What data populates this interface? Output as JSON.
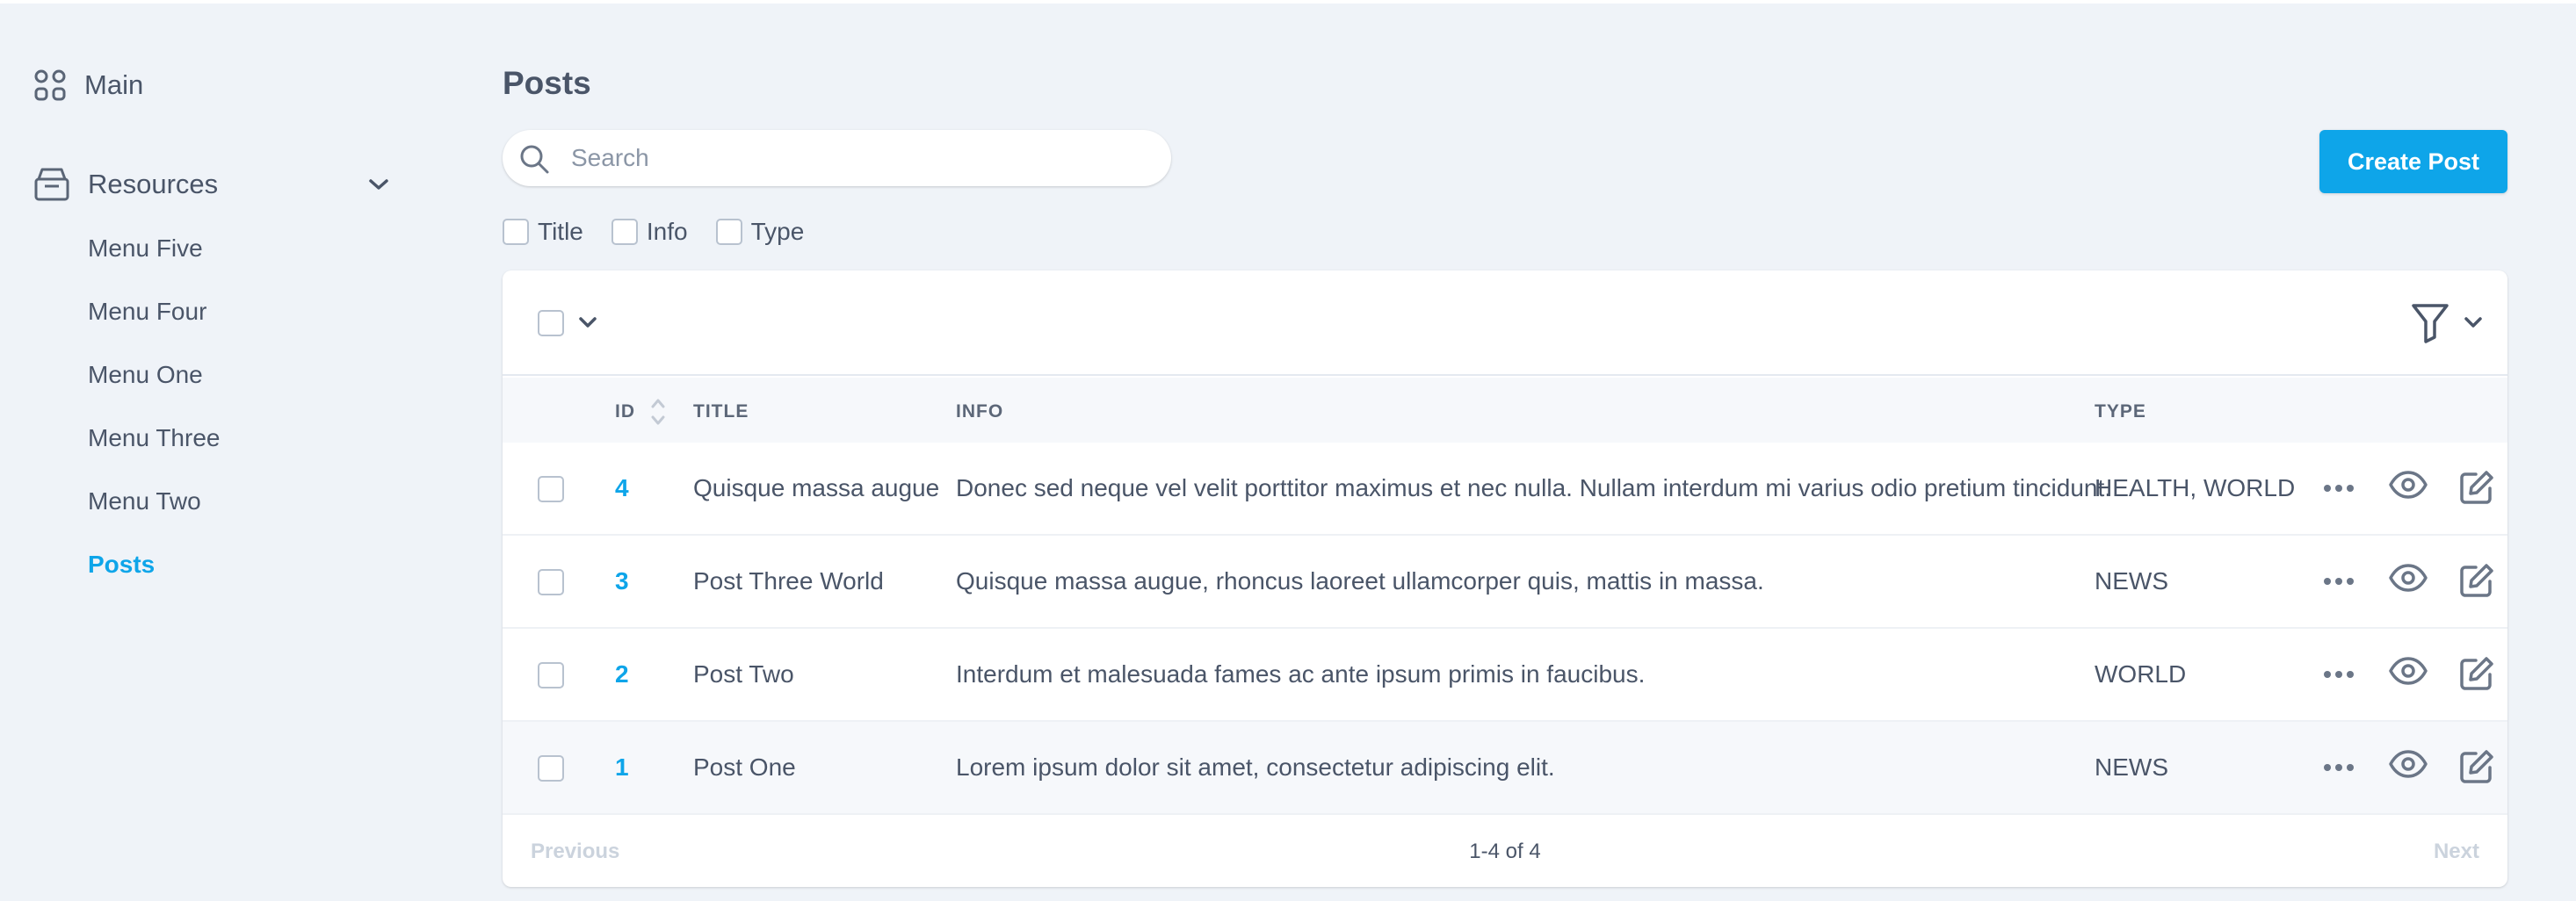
{
  "sidebar": {
    "main_label": "Main",
    "resources_label": "Resources",
    "items": [
      {
        "label": "Menu Five"
      },
      {
        "label": "Menu Four"
      },
      {
        "label": "Menu One"
      },
      {
        "label": "Menu Three"
      },
      {
        "label": "Menu Two"
      },
      {
        "label": "Posts",
        "active": true
      }
    ]
  },
  "page": {
    "title": "Posts",
    "search_placeholder": "Search",
    "search_value": "",
    "create_button": "Create Post"
  },
  "filters": [
    "Title",
    "Info",
    "Type"
  ],
  "table": {
    "columns": {
      "id": "ID",
      "title": "TITLE",
      "info": "INFO",
      "type": "TYPE"
    },
    "rows": [
      {
        "id": "4",
        "title": "Quisque massa augue",
        "info": "Donec sed neque vel velit porttitor maximus et nec nulla. Nullam interdum mi varius odio pretium tincidunt.",
        "type": "HEALTH, WORLD"
      },
      {
        "id": "3",
        "title": "Post Three World",
        "info": "Quisque massa augue, rhoncus laoreet ullamcorper quis, mattis in massa.",
        "type": "NEWS"
      },
      {
        "id": "2",
        "title": "Post Two",
        "info": "Interdum et malesuada fames ac ante ipsum primis in faucibus.",
        "type": "WORLD"
      },
      {
        "id": "1",
        "title": "Post One",
        "info": "Lorem ipsum dolor sit amet, consectetur adipiscing elit.",
        "type": "NEWS"
      }
    ]
  },
  "pagination": {
    "previous": "Previous",
    "count": "1-4 of 4",
    "next": "Next"
  },
  "colors": {
    "accent": "#0ea5e9",
    "background": "#eff3f8",
    "text": "#4a5568"
  }
}
